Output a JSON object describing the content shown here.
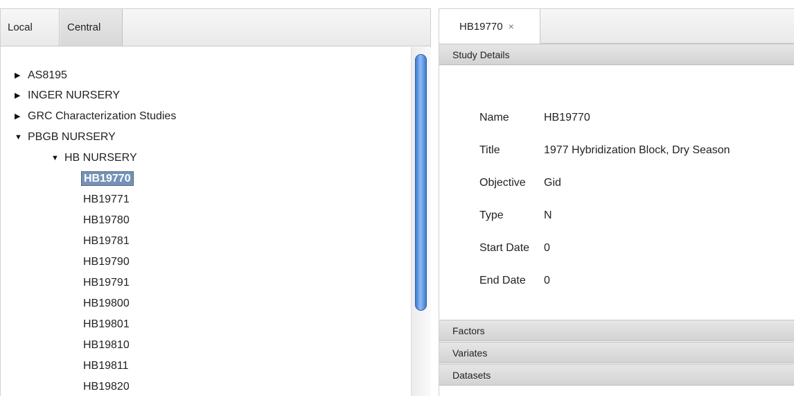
{
  "left": {
    "tabs": [
      {
        "label": "Local"
      },
      {
        "label": "Central"
      }
    ],
    "tree": [
      {
        "label": "AS8195",
        "expanded": false
      },
      {
        "label": "INGER NURSERY",
        "expanded": false
      },
      {
        "label": "GRC Characterization Studies",
        "expanded": false
      },
      {
        "label": "PBGB NURSERY",
        "expanded": true
      },
      {
        "label": "HB NURSERY",
        "expanded": true
      },
      {
        "label": "HB19770",
        "selected": true
      },
      {
        "label": "HB19771"
      },
      {
        "label": "HB19780"
      },
      {
        "label": "HB19781"
      },
      {
        "label": "HB19790"
      },
      {
        "label": "HB19791"
      },
      {
        "label": "HB19800"
      },
      {
        "label": "HB19801"
      },
      {
        "label": "HB19810"
      },
      {
        "label": "HB19811"
      },
      {
        "label": "HB19820"
      }
    ],
    "icons": {
      "collapsed": "triangle-right-icon",
      "expanded": "triangle-down-icon"
    }
  },
  "right": {
    "tab": {
      "label": "HB19770",
      "close_glyph": "×"
    },
    "sections": {
      "study_details": "Study Details",
      "factors": "Factors",
      "variates": "Variates",
      "datasets": "Datasets"
    },
    "details": [
      {
        "key": "Name",
        "value": "HB19770"
      },
      {
        "key": "Title",
        "value": "1977 Hybridization Block, Dry Season"
      },
      {
        "key": "Objective",
        "value": "Gid"
      },
      {
        "key": "Type",
        "value": "N"
      },
      {
        "key": "Start Date",
        "value": "0"
      },
      {
        "key": "End Date",
        "value": "0"
      }
    ]
  },
  "colors": {
    "selection": "#7593b8",
    "scroll_thumb": "#3e7ad6"
  }
}
